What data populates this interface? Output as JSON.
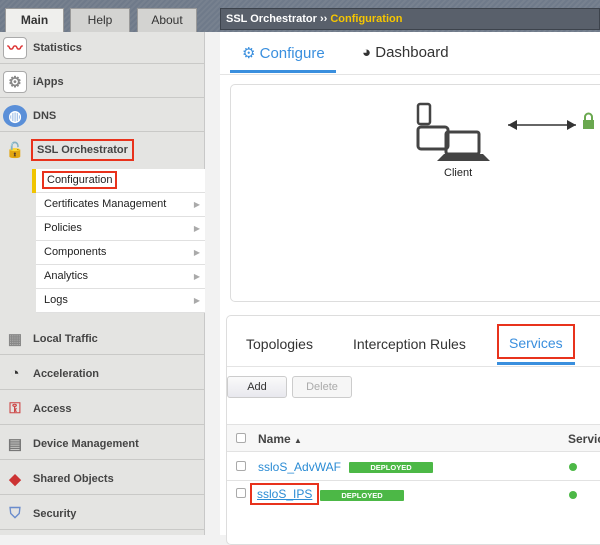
{
  "top_tabs": [
    "Main",
    "Help",
    "About"
  ],
  "sidebar": {
    "items": [
      {
        "label": "Statistics",
        "icon": "statistics-icon"
      },
      {
        "label": "iApps",
        "icon": "iapps-icon"
      },
      {
        "label": "DNS",
        "icon": "globe-icon"
      },
      {
        "label": "SSL Orchestrator",
        "icon": "padlock-icon"
      },
      {
        "label": "Local Traffic",
        "icon": "local-traffic-icon"
      },
      {
        "label": "Acceleration",
        "icon": "gauge-icon"
      },
      {
        "label": "Access",
        "icon": "access-icon"
      },
      {
        "label": "Device Management",
        "icon": "device-icon"
      },
      {
        "label": "Shared Objects",
        "icon": "shared-objects-icon"
      },
      {
        "label": "Security",
        "icon": "shield-icon"
      }
    ],
    "submenu": [
      "Configuration",
      "Certificates Management",
      "Policies",
      "Components",
      "Analytics",
      "Logs"
    ]
  },
  "breadcrumb": {
    "parent": "SSL Orchestrator",
    "separator": "››",
    "current": "Configuration"
  },
  "main_tabs": {
    "configure": "Configure",
    "dashboard": "Dashboard"
  },
  "diagram": {
    "client_label": "Client"
  },
  "sub_tabs": [
    "Topologies",
    "Interception Rules",
    "Services"
  ],
  "buttons": {
    "add": "Add",
    "delete": "Delete"
  },
  "table": {
    "columns": [
      "Name",
      "Servic"
    ],
    "sort_indicator": "▲",
    "rows": [
      {
        "name": "ssloS_AdvWAF",
        "badge": "DEPLOYED",
        "status": "green"
      },
      {
        "name": "ssloS_IPS",
        "badge": "DEPLOYED",
        "status": "green"
      }
    ]
  },
  "colors": {
    "accent": "#2a8bd4",
    "highlight": "#e8321c",
    "deployed": "#4cb846",
    "breadcrumb_current": "#f6c600"
  }
}
